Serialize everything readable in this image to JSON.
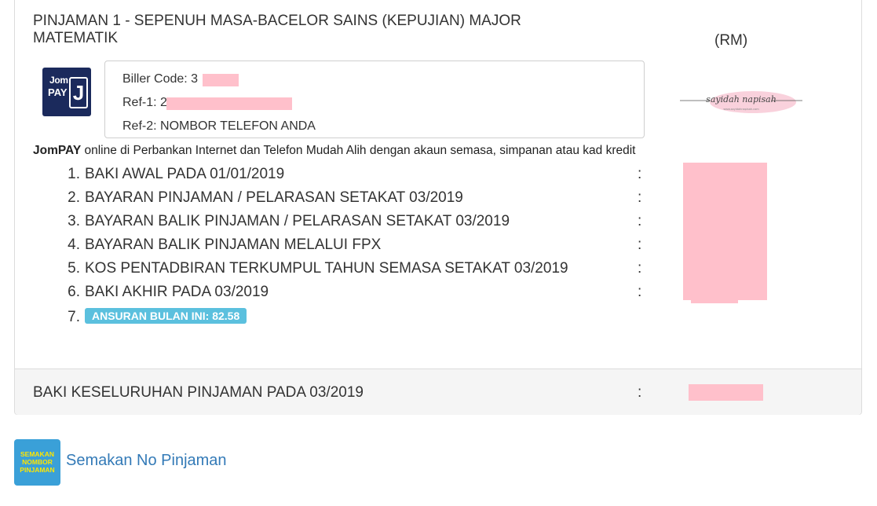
{
  "panel": {
    "title": "PINJAMAN 1 - SEPENUH MASA-BACELOR SAINS (KEPUJIAN) MAJOR MATEMATIK",
    "currency_label": "(RM)"
  },
  "jompay": {
    "logo_jom": "Jom",
    "logo_pay": "PAY",
    "logo_j": "J",
    "biller_code_label": "Biller Code: 3",
    "ref1_label": "Ref-1: 2",
    "ref2_label": "Ref-2: NOMBOR TELEFON ANDA",
    "desc_brand": "JomPAY",
    "desc_text": " online di Perbankan Internet dan Telefon Mudah Alih dengan akaun semasa, simpanan atau kad kredit"
  },
  "signature": {
    "text": "sayidah napisah",
    "subtext": "www.sayidahnapisah.com"
  },
  "items": [
    {
      "num": "1.",
      "label": "BAKI AWAL PADA 01/01/2019",
      "colon": ":"
    },
    {
      "num": "2.",
      "label": "BAYARAN PINJAMAN / PELARASAN SETAKAT 03/2019",
      "colon": ":"
    },
    {
      "num": "3.",
      "label": "BAYARAN BALIK PINJAMAN / PELARASAN SETAKAT 03/2019",
      "colon": ":"
    },
    {
      "num": "4.",
      "label": "BAYARAN BALIK PINJAMAN MELALUI FPX",
      "colon": ":"
    },
    {
      "num": "5.",
      "label": "KOS PENTADBIRAN TERKUMPUL TAHUN SEMASA SETAKAT 03/2019",
      "colon": ":"
    },
    {
      "num": "6.",
      "label": "BAKI AKHIR PADA 03/2019",
      "colon": ":"
    },
    {
      "num": "7.",
      "badge": "ANSURAN BULAN INI: 82.58"
    }
  ],
  "footer": {
    "label": "BAKI KESELURUHAN PINJAMAN PADA 03/2019",
    "colon": ":"
  },
  "semakan": {
    "icon_line1": "SEMAKAN",
    "icon_line2": "NOMBOR",
    "icon_line3": "PINJAMAN",
    "link_text": "Semakan No Pinjaman"
  },
  "colors": {
    "redaction": "#ffc0cb",
    "badge": "#5bc0de",
    "link": "#337ab7",
    "jompay_navy": "#1b2a5c"
  }
}
